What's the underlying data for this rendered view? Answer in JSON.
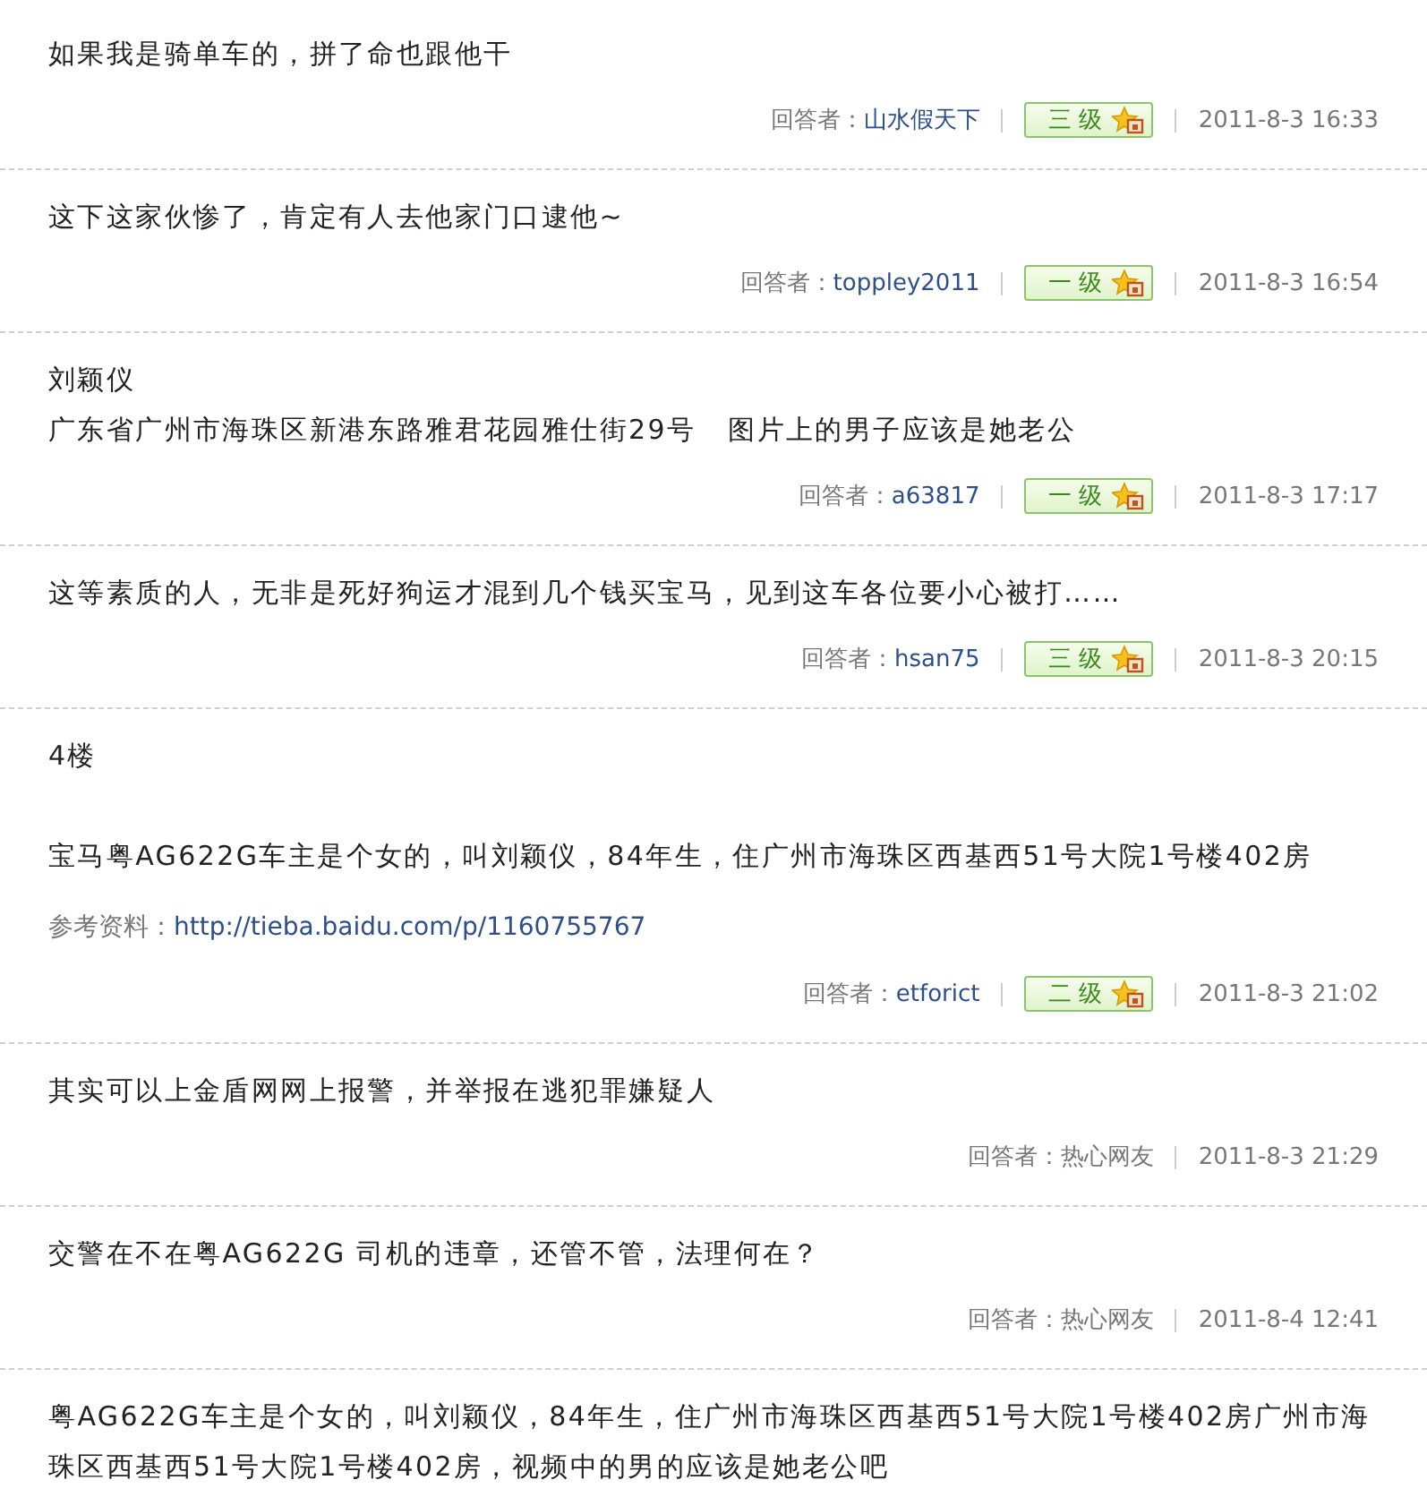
{
  "answers": [
    {
      "paragraphs": [
        {
          "text": "如果我是骑单车的，拼了命也跟他干",
          "spaced": false
        }
      ],
      "answerer_label": "回答者：",
      "answerer": "山水假天下",
      "registered": true,
      "rank": "三 级",
      "time": "2011-8-3 16:33"
    },
    {
      "paragraphs": [
        {
          "text": "这下这家伙惨了，肯定有人去他家门口逮他~",
          "spaced": false
        }
      ],
      "answerer_label": "回答者：",
      "answerer": "toppley2011",
      "registered": true,
      "rank": "一 级",
      "time": "2011-8-3 16:54"
    },
    {
      "paragraphs": [
        {
          "text": "刘颖仪",
          "spaced": false
        },
        {
          "text": "广东省广州市海珠区新港东路雅君花园雅仕街29号   图片上的男子应该是她老公",
          "spaced": false
        }
      ],
      "answerer_label": "回答者：",
      "answerer": "a63817",
      "registered": true,
      "rank": "一 级",
      "time": "2011-8-3 17:17"
    },
    {
      "paragraphs": [
        {
          "text": "这等素质的人，无非是死好狗运才混到几个钱买宝马，见到这车各位要小心被打……",
          "spaced": false
        }
      ],
      "answerer_label": "回答者：",
      "answerer": "hsan75",
      "registered": true,
      "rank": "三 级",
      "time": "2011-8-3 20:15"
    },
    {
      "paragraphs": [
        {
          "text": "4楼",
          "spaced": false
        },
        {
          "text": "宝马粤AG622G车主是个女的，叫刘颖仪，84年生，住广州市海珠区西基西51号大院1号楼402房",
          "spaced": true
        }
      ],
      "reference": {
        "label": "参考资料：",
        "url": "http://tieba.baidu.com/p/1160755767"
      },
      "answerer_label": "回答者：",
      "answerer": "etforict",
      "registered": true,
      "rank": "二 级",
      "time": "2011-8-3 21:02"
    },
    {
      "paragraphs": [
        {
          "text": "其实可以上金盾网网上报警，并举报在逃犯罪嫌疑人",
          "spaced": false
        }
      ],
      "answerer_label": "回答者：",
      "answerer": "热心网友",
      "registered": false,
      "time": "2011-8-3 21:29"
    },
    {
      "paragraphs": [
        {
          "text": "交警在不在粤AG622G 司机的违章，还管不管，法理何在？",
          "spaced": false
        }
      ],
      "answerer_label": "回答者：",
      "answerer": "热心网友",
      "registered": false,
      "time": "2011-8-4 12:41"
    },
    {
      "paragraphs": [
        {
          "text": "粤AG622G车主是个女的，叫刘颖仪，84年生，住广州市海珠区西基西51号大院1号楼402房广州市海珠区西基西51号大院1号楼402房，视频中的男的应该是她老公吧",
          "spaced": false
        }
      ]
    }
  ]
}
